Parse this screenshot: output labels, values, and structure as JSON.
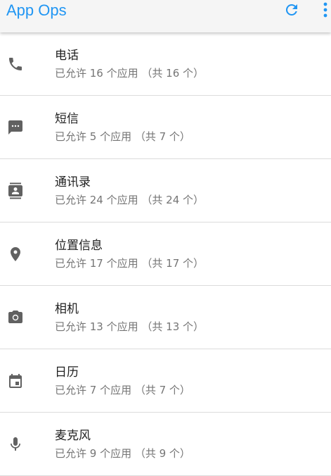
{
  "appbar": {
    "title": "App Ops",
    "accent": "#2196f3",
    "refresh_icon": "refresh-icon",
    "more_icon": "more-vert-icon"
  },
  "permissions": [
    {
      "icon": "phone-icon",
      "title": "电话",
      "subtitle": "已允许 16 个应用 （共 16 个）"
    },
    {
      "icon": "sms-icon",
      "title": "短信",
      "subtitle": "已允许 5 个应用 （共 7 个）"
    },
    {
      "icon": "contacts-icon",
      "title": "通讯录",
      "subtitle": "已允许 24 个应用 （共 24 个）"
    },
    {
      "icon": "location-icon",
      "title": "位置信息",
      "subtitle": "已允许 17 个应用 （共 17 个）"
    },
    {
      "icon": "camera-icon",
      "title": "相机",
      "subtitle": "已允许 13 个应用 （共 13 个）"
    },
    {
      "icon": "calendar-icon",
      "title": "日历",
      "subtitle": "已允许 7 个应用 （共 7 个）"
    },
    {
      "icon": "microphone-icon",
      "title": "麦克风",
      "subtitle": "已允许 9 个应用 （共 9 个）"
    }
  ]
}
